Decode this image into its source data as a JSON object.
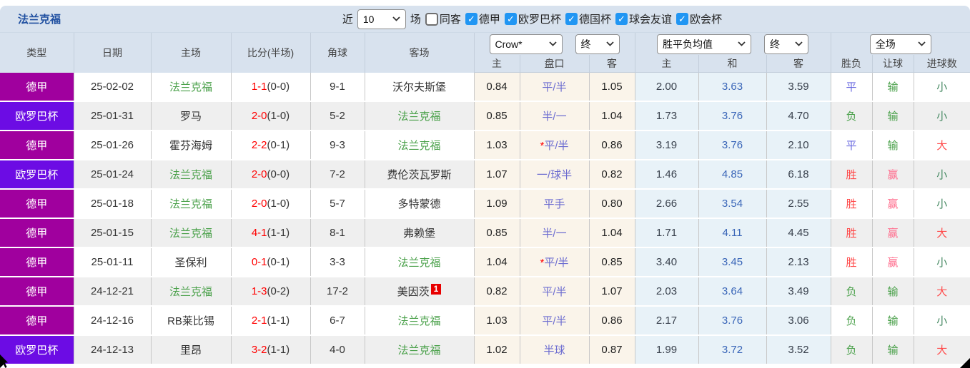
{
  "topbar": {
    "title": "法兰克福",
    "recent_label": "近",
    "recent_value": "10",
    "matches_label": "场",
    "same_opponent_label": "同客",
    "same_opponent_checked": false,
    "leagues": [
      {
        "label": "德甲",
        "checked": true
      },
      {
        "label": "欧罗巴杯",
        "checked": true
      },
      {
        "label": "德国杯",
        "checked": true
      },
      {
        "label": "球会友谊",
        "checked": true
      },
      {
        "label": "欧会杯",
        "checked": true
      }
    ]
  },
  "header": {
    "static_cols": [
      "类型",
      "日期",
      "主场",
      "比分(半场)",
      "角球",
      "客场"
    ],
    "odds_company_select": "Crow*",
    "odds_time_select": "终",
    "avg_select": "胜平负均值",
    "avg_time_select": "终",
    "scope_select": "全场",
    "sub_cols": [
      "主",
      "盘口",
      "客",
      "主",
      "和",
      "客",
      "胜负",
      "让球",
      "进球数"
    ]
  },
  "colors": {
    "bundesliga_badge": "#A0009E",
    "europa_badge": "#6C0CE4",
    "frankfurt_team_green": "#49A049",
    "score_red": "#FF0000",
    "handicap_blue": "#6B6BD0",
    "avg_draw_blue": "#3A66B8",
    "win_red": "#FF4A4A",
    "win_handicap_pink": "#FF6E8E",
    "draw_blue": "#6B6BE0",
    "goal_small_green": "#478A63",
    "topbar_bg": "#D8E2EE",
    "cream_col_bg": "#FAF4EA",
    "lightblue_col_bg": "#E8F2F8",
    "checkbox_blue": "#2196F3"
  },
  "rows": [
    {
      "type": "德甲",
      "league": "liga",
      "date": "25-02-02",
      "home": "法兰克福",
      "home_color": "green",
      "score": "1-1",
      "half": "(0-0)",
      "corner": "9-1",
      "away": "沃尔夫斯堡",
      "away_color": "dark",
      "odds_home": "0.84",
      "handicap": "平/半",
      "odds_away": "1.05",
      "avg_home": "2.00",
      "avg_draw": "3.63",
      "avg_away": "3.59",
      "wdl": "平",
      "wdl_color": "blue",
      "let": "输",
      "let_color": "green",
      "goal": "小",
      "goal_color": "goalgreen"
    },
    {
      "type": "欧罗巴杯",
      "league": "europa",
      "date": "25-01-31",
      "home": "罗马",
      "home_color": "dark",
      "score": "2-0",
      "half": "(1-0)",
      "corner": "5-2",
      "away": "法兰克福",
      "away_color": "green",
      "odds_home": "0.85",
      "handicap": "半/一",
      "odds_away": "1.04",
      "avg_home": "1.73",
      "avg_draw": "3.76",
      "avg_away": "4.70",
      "wdl": "负",
      "wdl_color": "green",
      "let": "输",
      "let_color": "green",
      "goal": "小",
      "goal_color": "goalgreen"
    },
    {
      "type": "德甲",
      "league": "liga",
      "date": "25-01-26",
      "home": "霍芬海姆",
      "home_color": "dark",
      "score": "2-2",
      "half": "(0-1)",
      "corner": "9-3",
      "away": "法兰克福",
      "away_color": "green",
      "odds_home": "1.03",
      "handicap_star": "*",
      "handicap": "平/半",
      "odds_away": "0.86",
      "avg_home": "3.19",
      "avg_draw": "3.76",
      "avg_away": "2.10",
      "wdl": "平",
      "wdl_color": "blue",
      "let": "输",
      "let_color": "green",
      "goal": "大",
      "goal_color": "red"
    },
    {
      "type": "欧罗巴杯",
      "league": "europa",
      "date": "25-01-24",
      "home": "法兰克福",
      "home_color": "green",
      "score": "2-0",
      "half": "(0-0)",
      "corner": "7-2",
      "away": "费伦茨瓦罗斯",
      "away_color": "dark",
      "odds_home": "1.07",
      "handicap": "一/球半",
      "odds_away": "0.82",
      "avg_home": "1.46",
      "avg_draw": "4.85",
      "avg_away": "6.18",
      "wdl": "胜",
      "wdl_color": "red",
      "let": "赢",
      "let_color": "pink",
      "goal": "小",
      "goal_color": "goalgreen"
    },
    {
      "type": "德甲",
      "league": "liga",
      "date": "25-01-18",
      "home": "法兰克福",
      "home_color": "green",
      "score": "2-0",
      "half": "(1-0)",
      "corner": "5-7",
      "away": "多特蒙德",
      "away_color": "dark",
      "odds_home": "1.09",
      "handicap": "平手",
      "odds_away": "0.80",
      "avg_home": "2.66",
      "avg_draw": "3.54",
      "avg_away": "2.55",
      "wdl": "胜",
      "wdl_color": "red",
      "let": "赢",
      "let_color": "pink",
      "goal": "小",
      "goal_color": "goalgreen"
    },
    {
      "type": "德甲",
      "league": "liga",
      "date": "25-01-15",
      "home": "法兰克福",
      "home_color": "green",
      "score": "4-1",
      "half": "(1-1)",
      "corner": "8-1",
      "away": "弗赖堡",
      "away_color": "dark",
      "odds_home": "0.85",
      "handicap": "半/一",
      "odds_away": "1.04",
      "avg_home": "1.71",
      "avg_draw": "4.11",
      "avg_away": "4.45",
      "wdl": "胜",
      "wdl_color": "red",
      "let": "赢",
      "let_color": "pink",
      "goal": "大",
      "goal_color": "red"
    },
    {
      "type": "德甲",
      "league": "liga",
      "date": "25-01-11",
      "home": "圣保利",
      "home_color": "dark",
      "score": "0-1",
      "half": "(0-1)",
      "corner": "3-3",
      "away": "法兰克福",
      "away_color": "green",
      "odds_home": "1.04",
      "handicap_star": "*",
      "handicap": "平/半",
      "odds_away": "0.85",
      "avg_home": "3.40",
      "avg_draw": "3.45",
      "avg_away": "2.13",
      "wdl": "胜",
      "wdl_color": "red",
      "let": "赢",
      "let_color": "pink",
      "goal": "小",
      "goal_color": "goalgreen"
    },
    {
      "type": "德甲",
      "league": "liga",
      "date": "24-12-21",
      "home": "法兰克福",
      "home_color": "green",
      "score": "1-3",
      "half": "(0-2)",
      "corner": "17-2",
      "away": "美因茨",
      "away_color": "dark",
      "away_badge": "1",
      "odds_home": "0.82",
      "handicap": "平/半",
      "odds_away": "1.07",
      "avg_home": "2.03",
      "avg_draw": "3.64",
      "avg_away": "3.49",
      "wdl": "负",
      "wdl_color": "green",
      "let": "输",
      "let_color": "green",
      "goal": "大",
      "goal_color": "red"
    },
    {
      "type": "德甲",
      "league": "liga",
      "date": "24-12-16",
      "home": "RB莱比锡",
      "home_color": "dark",
      "score": "2-1",
      "half": "(1-1)",
      "corner": "6-7",
      "away": "法兰克福",
      "away_color": "green",
      "odds_home": "1.03",
      "handicap": "平/半",
      "odds_away": "0.86",
      "avg_home": "2.17",
      "avg_draw": "3.76",
      "avg_away": "3.06",
      "wdl": "负",
      "wdl_color": "green",
      "let": "输",
      "let_color": "green",
      "goal": "小",
      "goal_color": "goalgreen"
    },
    {
      "type": "欧罗巴杯",
      "league": "europa",
      "date": "24-12-13",
      "home": "里昂",
      "home_color": "dark",
      "score": "3-2",
      "half": "(1-1)",
      "corner": "4-0",
      "away": "法兰克福",
      "away_color": "green",
      "odds_home": "1.02",
      "handicap": "半球",
      "odds_away": "0.87",
      "avg_home": "1.99",
      "avg_draw": "3.72",
      "avg_away": "3.52",
      "wdl": "负",
      "wdl_color": "green",
      "let": "输",
      "let_color": "green",
      "goal": "大",
      "goal_color": "red"
    }
  ]
}
